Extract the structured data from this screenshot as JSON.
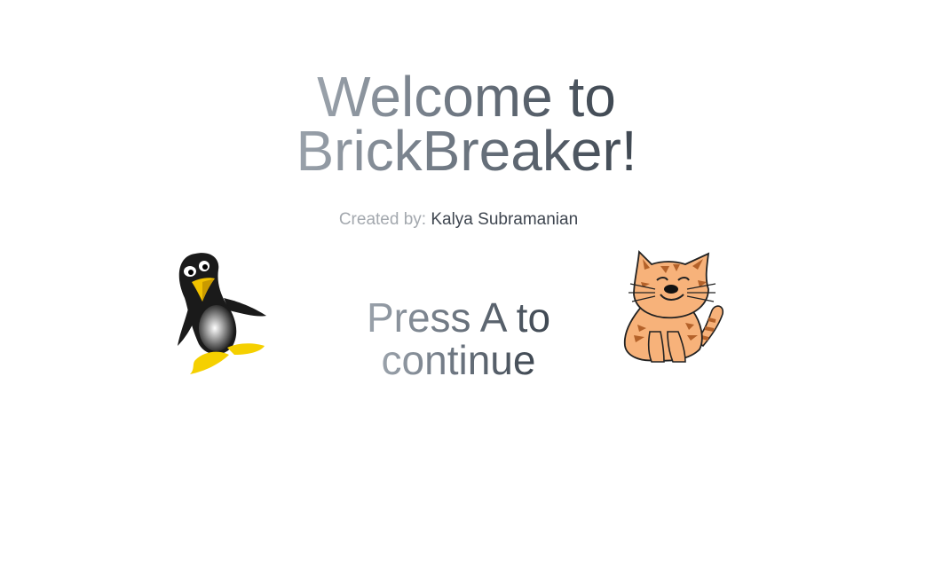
{
  "title": {
    "line1": "Welcome to",
    "line2": "BrickBreaker!"
  },
  "credit": {
    "label": "Created by:",
    "name": "Kalya Subramanian"
  },
  "prompt": {
    "line1": "Press A to",
    "line2": "continue"
  },
  "colors": {
    "text_light": "#9aa2ab",
    "text_dark": "#3f4852",
    "penguin_body": "#1a1a1a",
    "penguin_beak": "#f2c200",
    "cat_fur": "#f7b27a",
    "cat_stripes": "#b4622a"
  },
  "icons": {
    "penguin": "penguin-mascot",
    "cat": "cat-mascot"
  }
}
